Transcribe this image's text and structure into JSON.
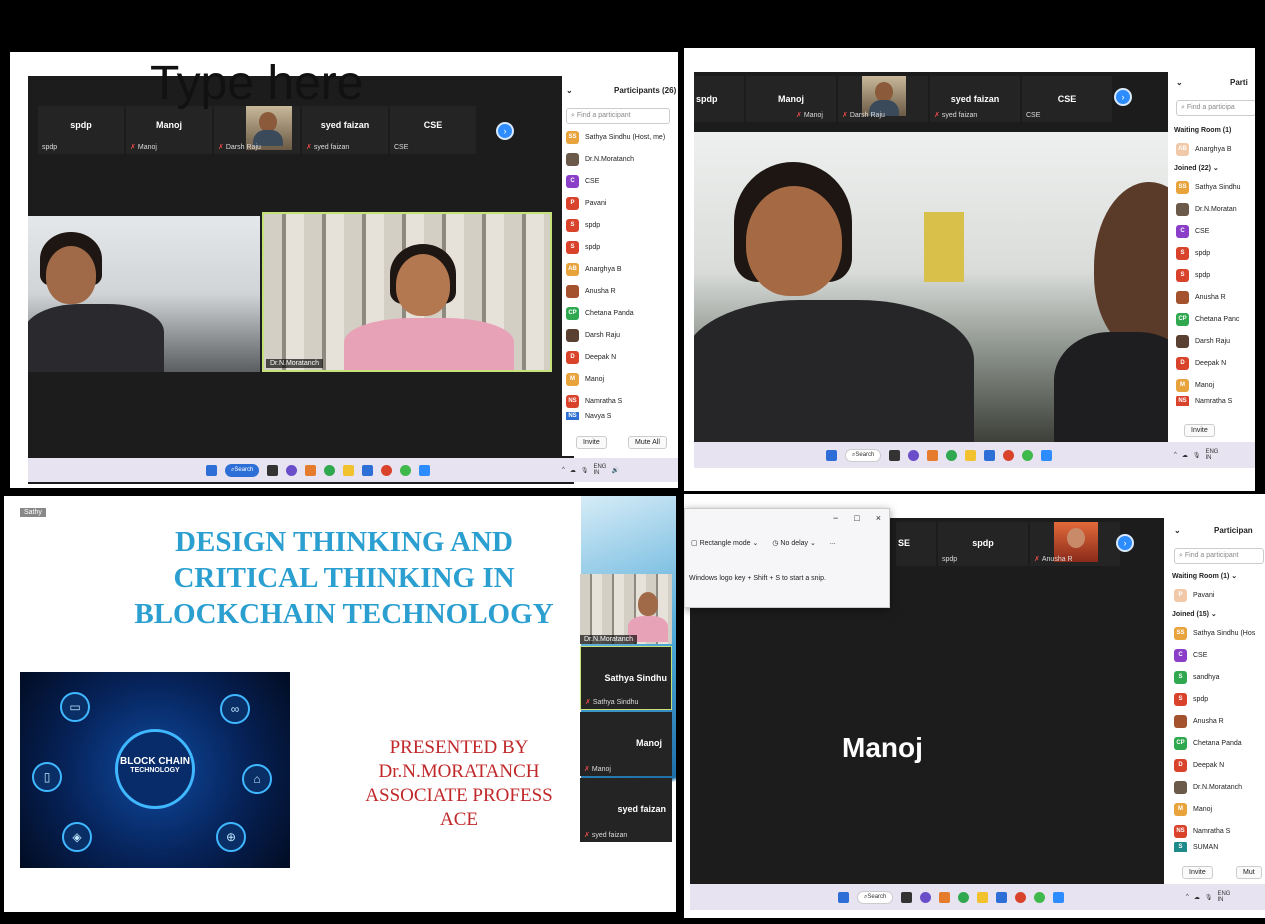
{
  "panel1": {
    "overlay_text": "Type here",
    "tiles": [
      {
        "name": "spdp",
        "sub": "spdp",
        "muted": false
      },
      {
        "name": "Manoj",
        "sub": "Manoj",
        "muted": true
      },
      {
        "name": "",
        "sub": "Darsh Raju",
        "muted": true
      },
      {
        "name": "syed faizan",
        "sub": "syed faizan",
        "muted": true
      },
      {
        "name": "CSE",
        "sub": "CSE",
        "muted": false
      }
    ],
    "video_label": "Dr.N.Moratanch",
    "sidebar": {
      "title": "Participants (26)",
      "search_placeholder": "Find a participant",
      "participants": [
        {
          "initials": "SS",
          "name": "Sathya Sindhu (Host, me)",
          "color": "#e8a33c"
        },
        {
          "initials": "",
          "name": "Dr.N.Moratanch",
          "color": "#6b5a4a"
        },
        {
          "initials": "C",
          "name": "CSE",
          "color": "#8b3fc9"
        },
        {
          "initials": "P",
          "name": "Pavani",
          "color": "#d9432c"
        },
        {
          "initials": "S",
          "name": "spdp",
          "color": "#d9432c"
        },
        {
          "initials": "S",
          "name": "spdp",
          "color": "#d9432c"
        },
        {
          "initials": "AB",
          "name": "Anarghya B",
          "color": "#e8a33c"
        },
        {
          "initials": "",
          "name": "Anusha R",
          "color": "#a4522e"
        },
        {
          "initials": "CP",
          "name": "Chetana Panda",
          "color": "#2fa84f"
        },
        {
          "initials": "",
          "name": "Darsh Raju",
          "color": "#5a4030"
        },
        {
          "initials": "D",
          "name": "Deepak N",
          "color": "#d9432c"
        },
        {
          "initials": "M",
          "name": "Manoj",
          "color": "#e8a33c"
        },
        {
          "initials": "NS",
          "name": "Namratha S",
          "color": "#d9432c"
        },
        {
          "initials": "NS",
          "name": "Navya S",
          "color": "#2d6fd6"
        }
      ],
      "invite": "Invite",
      "mute_all": "Mute All"
    },
    "taskbar": {
      "search": "Search",
      "lang": "ENG",
      "region": "IN"
    }
  },
  "panel2": {
    "tiles": [
      {
        "name": "spdp",
        "sub": "",
        "muted": false
      },
      {
        "name": "Manoj",
        "sub": "Manoj",
        "muted": true
      },
      {
        "name": "",
        "sub": "Darsh Raju",
        "muted": true
      },
      {
        "name": "syed faizan",
        "sub": "syed faizan",
        "muted": true
      },
      {
        "name": "CSE",
        "sub": "CSE",
        "muted": false
      }
    ],
    "sidebar": {
      "title": "Parti",
      "search_placeholder": "Find a participa",
      "waiting": "Waiting Room (1)",
      "waiting_people": [
        {
          "initials": "AB",
          "name": "Anarghya B",
          "color": "#f2c9a8"
        }
      ],
      "joined": "Joined (22)",
      "participants": [
        {
          "initials": "SS",
          "name": "Sathya Sindhu",
          "color": "#e8a33c"
        },
        {
          "initials": "",
          "name": "Dr.N.Moratan",
          "color": "#6b5a4a"
        },
        {
          "initials": "C",
          "name": "CSE",
          "color": "#8b3fc9"
        },
        {
          "initials": "S",
          "name": "spdp",
          "color": "#d9432c"
        },
        {
          "initials": "S",
          "name": "spdp",
          "color": "#d9432c"
        },
        {
          "initials": "",
          "name": "Anusha R",
          "color": "#a4522e"
        },
        {
          "initials": "CP",
          "name": "Chetana Panc",
          "color": "#2fa84f"
        },
        {
          "initials": "",
          "name": "Darsh Raju",
          "color": "#5a4030"
        },
        {
          "initials": "D",
          "name": "Deepak N",
          "color": "#d9432c"
        },
        {
          "initials": "M",
          "name": "Manoj",
          "color": "#e8a33c"
        },
        {
          "initials": "NS",
          "name": "Namratha S",
          "color": "#d9432c"
        }
      ],
      "invite": "Invite"
    },
    "taskbar": {
      "search": "Search",
      "lang": "ENG",
      "region": "IN"
    }
  },
  "panel3": {
    "badge": "Sathy",
    "title_lines": [
      "DESIGN THINKING AND",
      "CRITICAL THINKING  IN",
      "BLOCKCHAIN TECHNOLOGY"
    ],
    "presented_lines": [
      "PRESENTED BY",
      "Dr.N.MORATANCH",
      "ASSOCIATE PROFESS",
      "ACE"
    ],
    "bc_title": "BLOCK CHAIN",
    "bc_sub": "TECHNOLOGY",
    "video_label": "Dr.N.Moratanch",
    "tiles": [
      {
        "name": "Sathya Sindhu",
        "sub": "Sathya Sindhu"
      },
      {
        "name": "Manoj",
        "sub": "Manoj"
      },
      {
        "name": "syed faizan",
        "sub": "syed faizan"
      }
    ]
  },
  "panel4": {
    "snip": {
      "rect_mode": "Rectangle mode",
      "delay": "No delay",
      "more": "...",
      "hint": "Windows logo key + Shift + S to start a snip."
    },
    "tiles": [
      {
        "name": "SE",
        "sub": ""
      },
      {
        "name": "spdp",
        "sub": "spdp"
      },
      {
        "name": "",
        "sub": "Anusha R"
      }
    ],
    "big_name": "Manoj",
    "sidebar": {
      "title": "Participan",
      "search_placeholder": "Find a participant",
      "waiting": "Waiting Room (1)",
      "waiting_people": [
        {
          "initials": "P",
          "name": "Pavani",
          "color": "#f2c9a8"
        }
      ],
      "joined": "Joined (15)",
      "participants": [
        {
          "initials": "SS",
          "name": "Sathya Sindhu (Hos",
          "color": "#e8a33c"
        },
        {
          "initials": "C",
          "name": "CSE",
          "color": "#8b3fc9"
        },
        {
          "initials": "S",
          "name": "sandhya",
          "color": "#2fa84f"
        },
        {
          "initials": "S",
          "name": "spdp",
          "color": "#d9432c"
        },
        {
          "initials": "",
          "name": "Anusha R",
          "color": "#a4522e"
        },
        {
          "initials": "CP",
          "name": "Chetana Panda",
          "color": "#2fa84f"
        },
        {
          "initials": "D",
          "name": "Deepak N",
          "color": "#d9432c"
        },
        {
          "initials": "",
          "name": "Dr.N.Moratanch",
          "color": "#6b5a4a"
        },
        {
          "initials": "M",
          "name": "Manoj",
          "color": "#e8a33c"
        },
        {
          "initials": "NS",
          "name": "Namratha S",
          "color": "#d9432c"
        },
        {
          "initials": "S",
          "name": "SUMAN",
          "color": "#1f8a8a"
        }
      ],
      "invite": "Invite",
      "mute_all": "Mut"
    },
    "taskbar": {
      "search": "Search",
      "lang": "ENG",
      "region": "IN"
    }
  },
  "colors": {
    "accent": "#2d8cff",
    "meeting_bg": "#1c1c1c",
    "slide_title": "#2a9fd0",
    "slide_red": "#c0282a"
  }
}
